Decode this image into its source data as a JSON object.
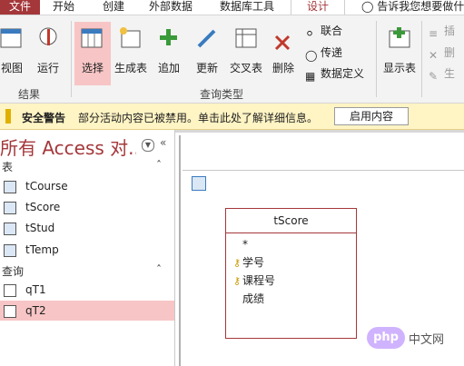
{
  "tabs": [
    "文件",
    "开始",
    "创建",
    "外部数据",
    "数据库工具",
    "设计"
  ],
  "tell_me": "告诉我您想要做什",
  "ribbon": {
    "results": {
      "label": "结果",
      "buttons": [
        "视图",
        "运行"
      ]
    },
    "query_type": {
      "label": "查询类型",
      "buttons": [
        "选择",
        "生成表",
        "追加",
        "更新",
        "交叉表",
        "删除"
      ],
      "small": [
        "联合",
        "传递",
        "数据定义"
      ]
    },
    "show_table": "显示表",
    "right_cmds": [
      "插",
      "删",
      "生"
    ]
  },
  "security": {
    "title": "安全警告",
    "message": "部分活动内容已被禁用。单击此处了解详细信息。",
    "button": "启用内容"
  },
  "nav": {
    "title": "所有 Access 对...",
    "sections": [
      {
        "label": "表",
        "items": [
          "tCourse",
          "tScore",
          "tStud",
          "tTemp"
        ]
      },
      {
        "label": "查询",
        "items": [
          "qT1",
          "qT2"
        ]
      }
    ]
  },
  "table_box": {
    "title": "tScore",
    "fields": [
      "*",
      "学号",
      "课程号",
      "成绩"
    ],
    "key_fields": [
      false,
      true,
      true,
      false
    ]
  },
  "watermark": {
    "badge": "php",
    "text": "中文网"
  },
  "colors": {
    "accent": "#a4373a",
    "selected": "#f7c5c5",
    "warning": "#fff4c4"
  }
}
